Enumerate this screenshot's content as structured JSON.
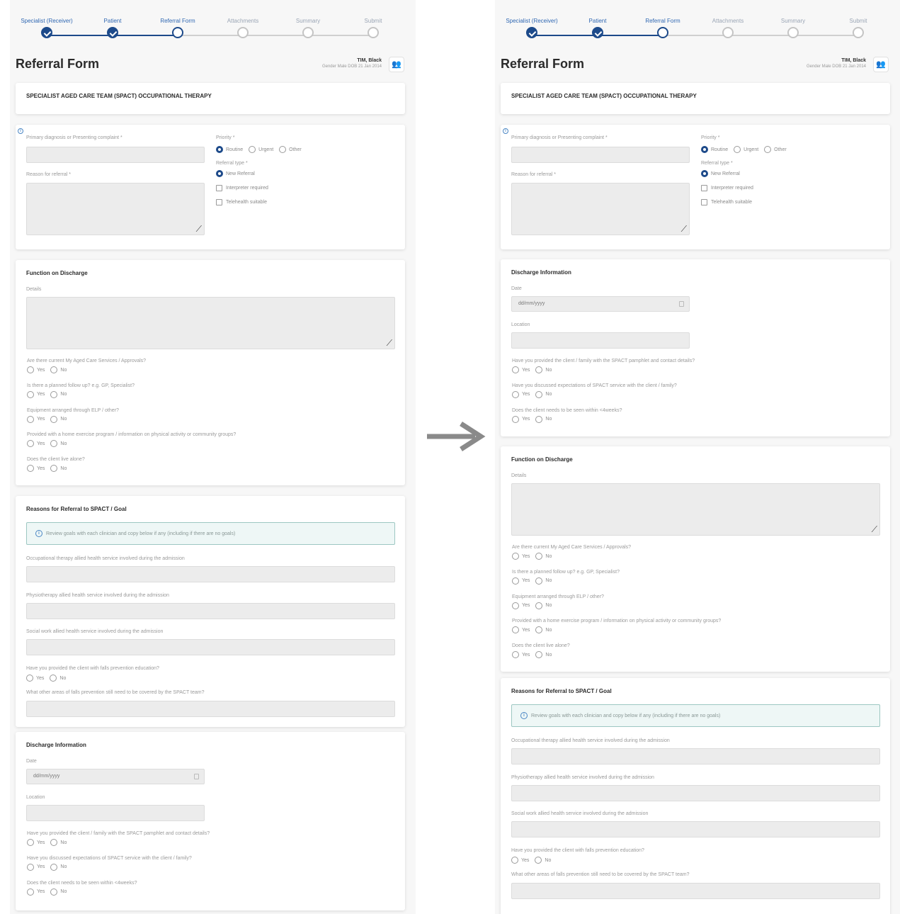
{
  "stepper": {
    "steps": [
      {
        "label": "Specialist (Receiver)",
        "state": "done"
      },
      {
        "label": "Patient",
        "state": "done"
      },
      {
        "label": "Referral Form",
        "state": "current"
      },
      {
        "label": "Attachments",
        "state": "todo"
      },
      {
        "label": "Summary",
        "state": "todo"
      },
      {
        "label": "Submit",
        "state": "todo"
      }
    ]
  },
  "header": {
    "title": "Referral Form",
    "patient_name": "TIM, Black",
    "patient_gender": "Gender Male",
    "patient_dob": "DOB 21 Jan 2014",
    "patient_icon": "people-icon"
  },
  "form": {
    "team_title": "SPECIALIST AGED CARE TEAM (SPACT) OCCUPATIONAL THERAPY",
    "primary_diagnosis_label": "Primary diagnosis or Presenting complaint *",
    "reason_label": "Reason for referral *",
    "priority_label": "Priority *",
    "priority_options": [
      "Routine",
      "Urgent",
      "Other"
    ],
    "priority_selected": "Routine",
    "referral_type_label": "Referral type *",
    "referral_type_option": "New Referral",
    "interpreter_label": "Interpreter required",
    "telehealth_label": "Telehealth suitable"
  },
  "yes_no": {
    "yes": "Yes",
    "no": "No"
  },
  "function_on_discharge": {
    "heading": "Function on Discharge",
    "details_label": "Details",
    "questions": [
      "Are there current My Aged Care Services / Approvals?",
      "Is there a planned follow up? e.g. GP, Specialist?",
      "Equipment arranged through ELP / other?",
      "Provided with a home exercise program / information on physical activity or community groups?",
      "Does the client live alone?"
    ]
  },
  "reasons_for_referral": {
    "heading": "Reasons for Referral to SPACT / Goal",
    "info_text": "Review goals with each clinician and copy below if any (including if there are no goals)",
    "ot_label": "Occupational therapy allied health service involved during the admission",
    "physio_label": "Physiotherapy allied health service involved during the admission",
    "social_label": "Social work allied health service involved during the admission",
    "falls_question": "Have you provided the client with falls prevention education?",
    "falls_areas_label": "What other areas of falls prevention still need to be covered by the SPACT team?"
  },
  "discharge_information": {
    "heading": "Discharge Information",
    "date_label": "Date",
    "date_placeholder": "dd/mm/yyyy",
    "location_label": "Location",
    "questions": [
      "Have you provided the client / family with the SPACT pamphlet and contact details?",
      "Have you discussed expectations of SPACT service with the client / family?",
      "Does the client needs to be seen within <4weeks?"
    ]
  },
  "icons": {
    "transition_arrow": "right-arrow-icon",
    "info": "info-icon",
    "calendar": "calendar-icon",
    "resize": "resize-handle-icon"
  },
  "colors": {
    "primary": "#1d4a8a",
    "step_active_label": "#2f67b2",
    "info_bg": "#eef7f6",
    "info_border": "#9dc7c2",
    "patient_icon": "#7a4cc3",
    "arrow": "#8a8a8a"
  }
}
